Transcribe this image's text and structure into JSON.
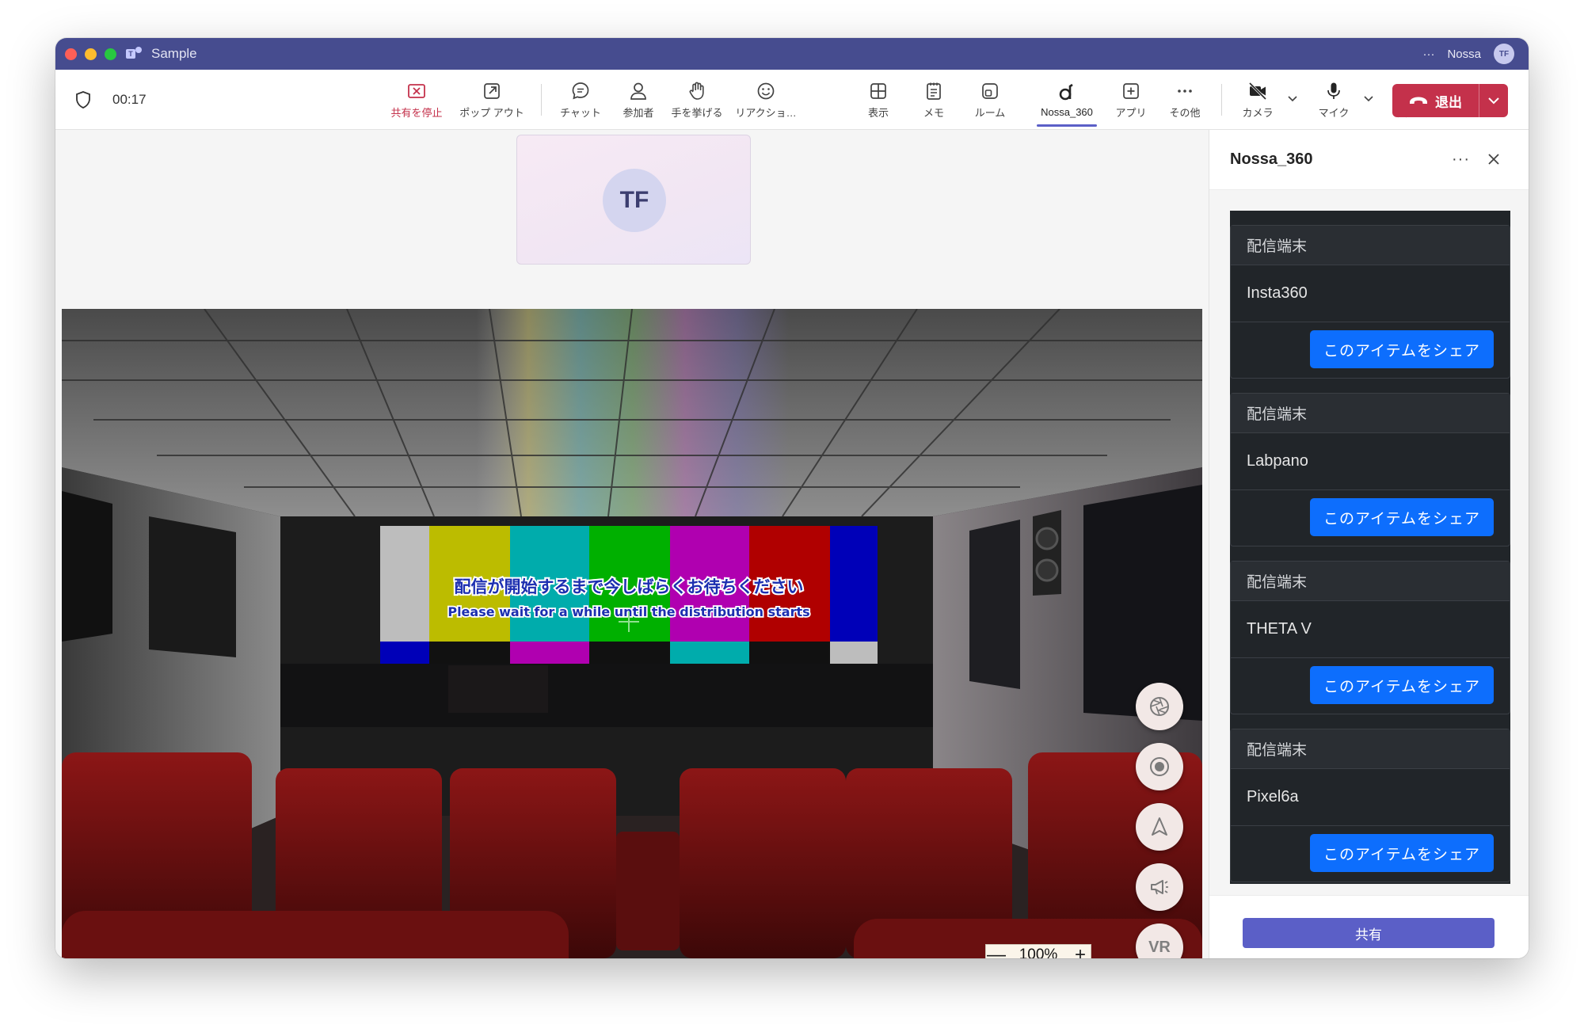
{
  "window": {
    "title": "Sample",
    "user_name": "Nossa",
    "user_initials": "TF",
    "more": "···"
  },
  "toolbar": {
    "timer": "00:17",
    "items": [
      {
        "id": "stop-share",
        "label": "共有を停止",
        "icon": "stop-share-icon"
      },
      {
        "id": "popout",
        "label": "ポップ アウト",
        "icon": "popout-icon"
      },
      {
        "id": "chat",
        "label": "チャット",
        "icon": "chat-icon"
      },
      {
        "id": "participants",
        "label": "参加者",
        "icon": "person-icon"
      },
      {
        "id": "raise-hand",
        "label": "手を挙げる",
        "icon": "hand-icon"
      },
      {
        "id": "reactions",
        "label": "リアクショ…",
        "icon": "smile-icon"
      },
      {
        "id": "view",
        "label": "表示",
        "icon": "grid-icon"
      },
      {
        "id": "notes",
        "label": "メモ",
        "icon": "notes-icon"
      },
      {
        "id": "rooms",
        "label": "ルーム",
        "icon": "rooms-icon"
      },
      {
        "id": "nossa360",
        "label": "Nossa_360",
        "icon": "nossa-icon"
      },
      {
        "id": "apps",
        "label": "アプリ",
        "icon": "plus-icon"
      },
      {
        "id": "more",
        "label": "その他",
        "icon": "more-icon"
      },
      {
        "id": "camera",
        "label": "カメラ",
        "icon": "camera-off-icon"
      },
      {
        "id": "mic",
        "label": "マイク",
        "icon": "mic-icon"
      },
      {
        "id": "share",
        "label": "共有",
        "icon": "share-icon"
      }
    ],
    "leave_label": "退出"
  },
  "stage": {
    "self_initials": "TF",
    "screen_text_jp": "配信が開始するまで今しばらくお待ちください",
    "screen_text_en": "Please wait for a while until the distribution starts",
    "zoom_value": "100%",
    "zoom_minus": "—",
    "zoom_plus": "+",
    "vr_label": "VR"
  },
  "panel": {
    "title": "Nossa_360",
    "more": "···",
    "devices": [
      {
        "header": "配信端末",
        "name": "Insta360",
        "button": "このアイテムをシェア"
      },
      {
        "header": "配信端末",
        "name": "Labpano",
        "button": "このアイテムをシェア"
      },
      {
        "header": "配信端末",
        "name": "THETA V",
        "button": "このアイテムをシェア"
      },
      {
        "header": "配信端末",
        "name": "Pixel6a",
        "button": "このアイテムをシェア"
      }
    ],
    "share_label": "共有"
  },
  "colors": {
    "title_bar": "#464c8f",
    "accent": "#5b5fc7",
    "leave": "#c4314b",
    "device_button": "#0d6efd",
    "device_list_bg": "#212529"
  }
}
